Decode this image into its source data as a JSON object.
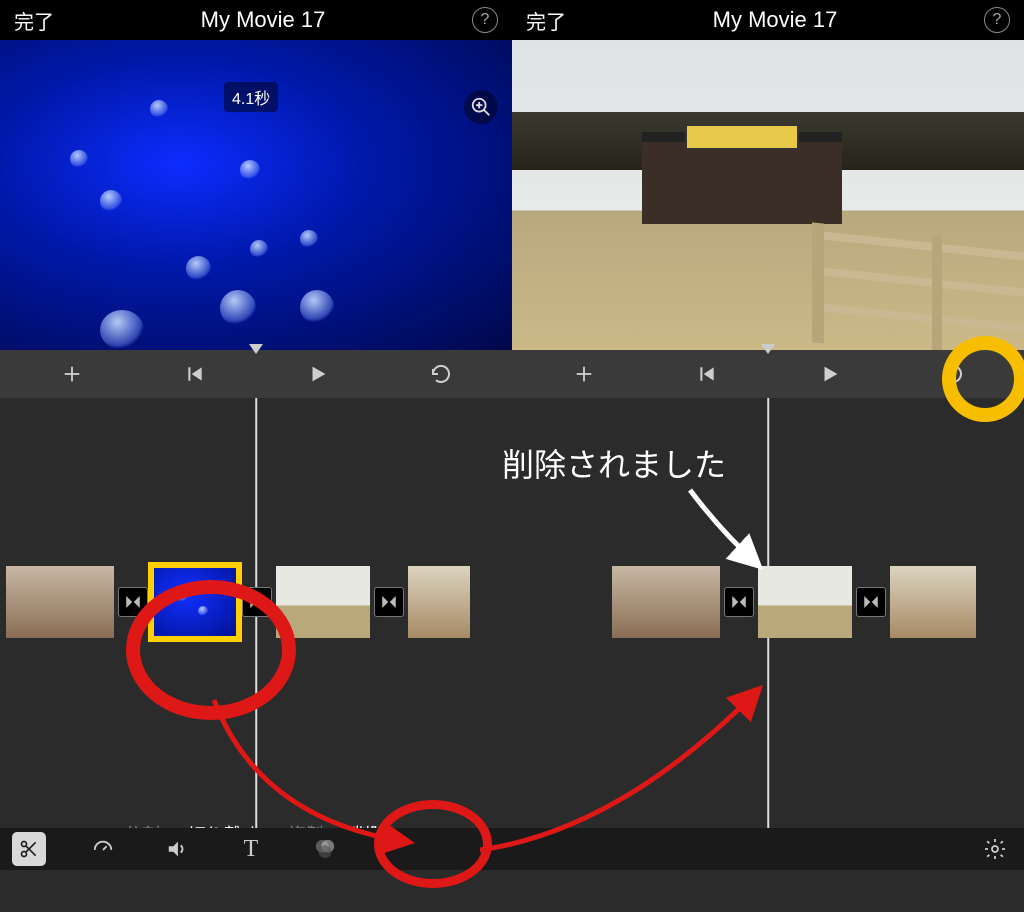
{
  "left": {
    "done": "完了",
    "title": "My Movie 17",
    "duration": "4.1秒",
    "editMenu": {
      "split": "分割",
      "detach": "切り離す",
      "duplicate": "複製",
      "delete": "削除"
    }
  },
  "right": {
    "done": "完了",
    "title": "My Movie 17"
  },
  "annotation": {
    "deleted": "削除されました"
  }
}
